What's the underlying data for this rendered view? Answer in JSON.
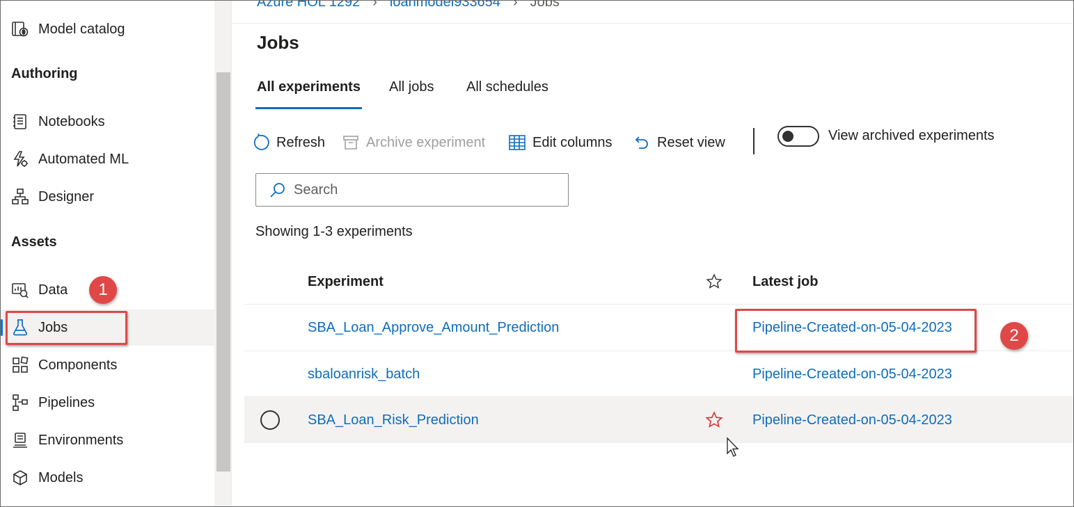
{
  "sidebar": {
    "model_catalog": "Model catalog",
    "authoring_title": "Authoring",
    "authoring_items": [
      {
        "label": "Notebooks",
        "icon": "notebook-icon"
      },
      {
        "label": "Automated ML",
        "icon": "automated-ml-icon"
      },
      {
        "label": "Designer",
        "icon": "designer-icon"
      }
    ],
    "assets_title": "Assets",
    "asset_items": [
      {
        "label": "Data",
        "icon": "data-icon"
      },
      {
        "label": "Jobs",
        "icon": "flask-icon",
        "active": true
      },
      {
        "label": "Components",
        "icon": "components-icon"
      },
      {
        "label": "Pipelines",
        "icon": "pipelines-icon"
      },
      {
        "label": "Environments",
        "icon": "environments-icon"
      },
      {
        "label": "Models",
        "icon": "cube-icon"
      }
    ]
  },
  "breadcrumb": [
    "Azure HOL 1292",
    "loanmodel933654",
    "Jobs"
  ],
  "page_title": "Jobs",
  "tabs": [
    {
      "label": "All experiments",
      "active": true
    },
    {
      "label": "All jobs"
    },
    {
      "label": "All schedules"
    }
  ],
  "toolbar": {
    "refresh": "Refresh",
    "archive": "Archive experiment",
    "edit_columns": "Edit columns",
    "reset_view": "Reset view",
    "view_archived": "View archived experiments"
  },
  "search": {
    "placeholder": "Search",
    "value": ""
  },
  "showing_text": "Showing 1-3 experiments",
  "table": {
    "columns": [
      "Experiment",
      "Latest job"
    ],
    "rows": [
      {
        "experiment": "SBA_Loan_Approve_Amount_Prediction",
        "latest_job": "Pipeline-Created-on-05-04-2023"
      },
      {
        "experiment": "sbaloanrisk_batch",
        "latest_job": "Pipeline-Created-on-05-04-2023"
      },
      {
        "experiment": "SBA_Loan_Risk_Prediction",
        "latest_job": "Pipeline-Created-on-05-04-2023"
      }
    ]
  },
  "annotations": {
    "badge_1": "1",
    "badge_2": "2"
  },
  "colors": {
    "link": "#0f6cbd",
    "accent": "#0078d4",
    "callout": "#e04848",
    "favorite_star": "#d13438"
  }
}
